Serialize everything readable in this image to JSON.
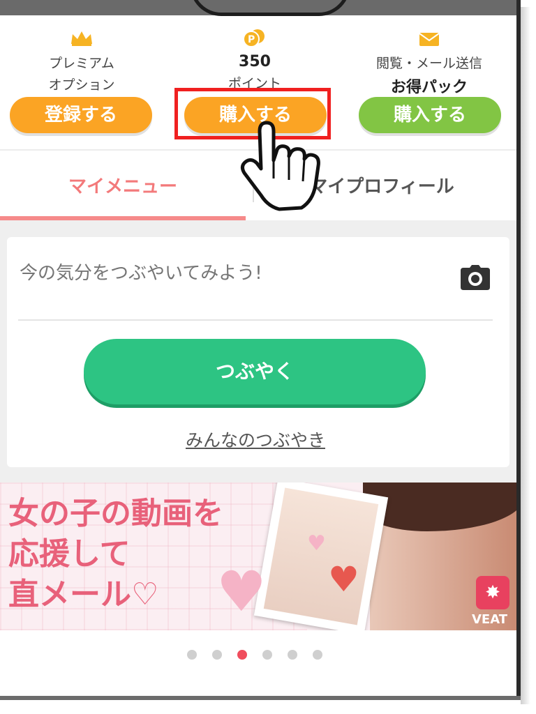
{
  "options": {
    "premium": {
      "line1": "プレミアム",
      "line2": "オプション",
      "button": "登録する"
    },
    "points": {
      "value": "350",
      "label": "ポイント",
      "button": "購入する"
    },
    "pack": {
      "line1": "閲覧・メール送信",
      "line2": "お得パック",
      "button": "購入する"
    }
  },
  "tabs": {
    "my_menu": "マイメニュー",
    "my_profile": "マイプロフィール"
  },
  "post": {
    "placeholder": "今の気分をつぶやいてみよう!",
    "submit": "つぶやく",
    "everyone_link": "みんなのつぶやき"
  },
  "banner": {
    "line1": "女の子の動画を",
    "line2": "応援して",
    "line3": "直メール♡",
    "badge": "VEAT"
  },
  "carousel": {
    "count": 6,
    "active_index": 2
  },
  "colors": {
    "orange": "#fba424",
    "green": "#82c544",
    "tweet_green": "#2dc483",
    "tab_pink": "#f3797a",
    "highlight_red": "#f02020"
  },
  "icons": [
    "crown-icon",
    "coin-icon",
    "mail-icon",
    "camera-icon",
    "hand-pointer-icon"
  ]
}
